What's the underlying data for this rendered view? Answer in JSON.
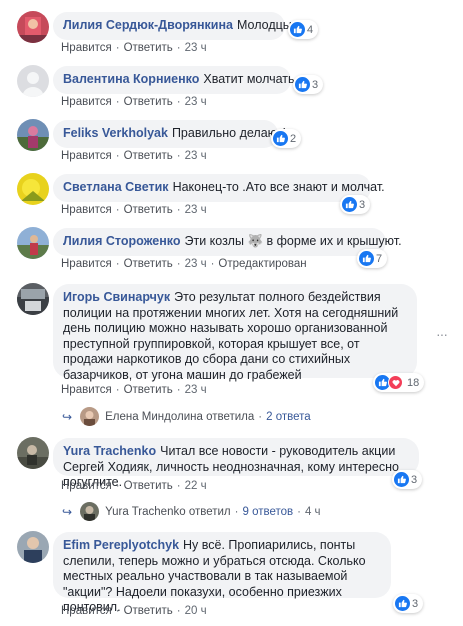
{
  "labels": {
    "like": "Нравится",
    "reply": "Ответить",
    "edited": "Отредактирован"
  },
  "comments": [
    {
      "author": "Лилия Сердюк-Дворянкина",
      "text": "Молодцы",
      "time": "23 ч",
      "reactions": "4"
    },
    {
      "author": "Валентина Корниенко",
      "text": "Хватит молчать....",
      "time": "23 ч",
      "reactions": "3"
    },
    {
      "author": "Feliks Verkholyak",
      "text": "Правильно делают!",
      "time": "23 ч",
      "reactions": "2"
    },
    {
      "author": "Светлана Светик",
      "text": "Наконец-то .Ато все знают и молчат.",
      "time": "23 ч",
      "reactions": "3"
    },
    {
      "author": "Лилия Стороженко",
      "text_before": "Эти козлы",
      "emoji": "🐺",
      "text_after": "в форме их и крышуют.",
      "time": "23 ч",
      "reactions": "7"
    },
    {
      "author": "Игорь Свинарчук",
      "text": "Это результат полного бездействия полиции на протяжении многих лет. Хотя на сегодняшний день полицию можно называть хорошо организованной преступной группировкой, которая крышует все, от продажи наркотиков до сбора дани со стихийных базарчиков, от угона машин до грабежей",
      "time": "23 ч",
      "reactions": "18"
    },
    {
      "author": "Yura Trachenko",
      "text": "Читал все новости - руководитель акции Сергей Ходияк, личность неоднозначная, кому интересно погуглите.",
      "time": "22 ч",
      "reactions": "3"
    },
    {
      "author": "Efim Pereplyotchyk",
      "text": "Ну всё. Пропиарились, понты слепили, теперь можно и убраться отсюда. Сколько местных реально участвовали в так называемой \"акции\"? Надоели показухи, особенно приезжих понтовил.",
      "time": "20 ч",
      "reactions": "3"
    }
  ],
  "replies": [
    {
      "name": "Елена Миндолина",
      "verb": "ответила",
      "count": "2 ответа",
      "time": ""
    },
    {
      "name": "Yura Trachenko",
      "verb": "ответил",
      "count": "9 ответов",
      "time": "4 ч"
    }
  ],
  "colors": {
    "link": "#385898",
    "bubble": "#f2f3f5",
    "like": "#1877f2",
    "love": "#f33e58"
  },
  "icons": [
    "like-icon",
    "love-icon",
    "reply-arrow-icon",
    "more-options-icon"
  ]
}
